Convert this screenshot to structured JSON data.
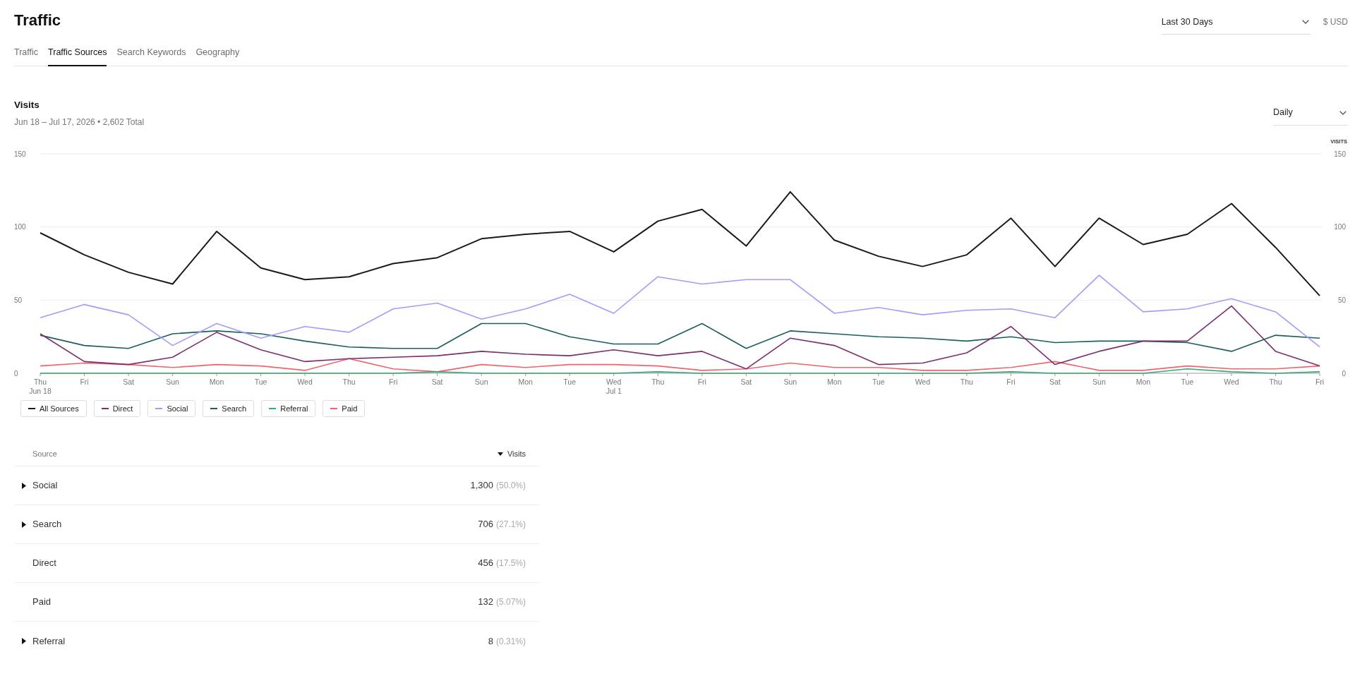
{
  "header": {
    "title": "Traffic",
    "date_range": "Last 30 Days",
    "currency": "$ USD"
  },
  "tabs": [
    {
      "label": "Traffic",
      "selected": false
    },
    {
      "label": "Traffic Sources",
      "selected": true
    },
    {
      "label": "Search Keywords",
      "selected": false
    },
    {
      "label": "Geography",
      "selected": false
    }
  ],
  "visits_panel": {
    "title": "Visits",
    "subtitle": "Jun 18 – Jul 17, 2026 • 2,602 Total",
    "interval": "Daily",
    "right_axis": {
      "ticks": [
        "150",
        "100",
        "50",
        "0"
      ]
    },
    "chart_data": {
      "type": "line",
      "ylabel": "VISITS",
      "categories": [
        "Thu\nJun 18",
        "Fri",
        "Sat",
        "Sun",
        "Mon",
        "Tue",
        "Wed",
        "Thu",
        "Fri",
        "Sat",
        "Sun",
        "Mon",
        "Tue",
        "Wed\nJul 1",
        "Thu",
        "Fri",
        "Sat",
        "Sun",
        "Mon",
        "Tue",
        "Wed",
        "Thu",
        "Fri",
        "Sat",
        "Sun",
        "Mon",
        "Tue",
        "Wed",
        "Thu",
        "Fri"
      ],
      "ylim": [
        0,
        150
      ],
      "yticks": [
        0,
        50,
        100,
        150
      ],
      "series": [
        {
          "name": "All Sources",
          "color": "#1a1a1a",
          "values": [
            96,
            81,
            69,
            61,
            97,
            72,
            64,
            66,
            75,
            79,
            92,
            95,
            97,
            83,
            104,
            112,
            87,
            124,
            91,
            80,
            73,
            81,
            106,
            73,
            106,
            88,
            95,
            116,
            86,
            53
          ]
        },
        {
          "name": "Direct",
          "color": "#7d2e6f",
          "values": [
            27,
            8,
            6,
            11,
            28,
            16,
            8,
            10,
            11,
            12,
            15,
            13,
            12,
            16,
            12,
            15,
            3,
            24,
            19,
            6,
            7,
            14,
            32,
            6,
            15,
            22,
            22,
            46,
            15,
            5
          ]
        },
        {
          "name": "Social",
          "color": "#a29cff",
          "values": [
            38,
            47,
            40,
            19,
            34,
            24,
            32,
            28,
            44,
            48,
            37,
            44,
            54,
            41,
            66,
            61,
            64,
            64,
            41,
            45,
            40,
            43,
            44,
            38,
            67,
            42,
            44,
            51,
            42,
            18
          ]
        },
        {
          "name": "Search",
          "color": "#1b5e5b",
          "values": [
            26,
            19,
            17,
            27,
            29,
            27,
            22,
            18,
            17,
            17,
            34,
            34,
            25,
            20,
            20,
            34,
            17,
            29,
            27,
            25,
            24,
            22,
            25,
            21,
            22,
            22,
            21,
            15,
            26,
            24
          ]
        },
        {
          "name": "Referral",
          "color": "#3aa876",
          "values": [
            0,
            0,
            0,
            0,
            0,
            0,
            0,
            0,
            0,
            1,
            0,
            0,
            0,
            0,
            1,
            0,
            0,
            0,
            0,
            0,
            0,
            0,
            1,
            0,
            0,
            0,
            3,
            1,
            0,
            1
          ]
        },
        {
          "name": "Paid",
          "color": "#f2646c",
          "values": [
            5,
            7,
            6,
            4,
            6,
            5,
            2,
            10,
            3,
            1,
            6,
            4,
            6,
            6,
            5,
            2,
            3,
            7,
            4,
            4,
            2,
            2,
            4,
            8,
            2,
            2,
            5,
            3,
            3,
            5
          ]
        }
      ]
    }
  },
  "table": {
    "columns": [
      {
        "label": "Source",
        "sorted": false
      },
      {
        "label": "Visits",
        "sorted": true
      }
    ],
    "rows": [
      {
        "source": "Social",
        "visits": "1,300",
        "share": "(50.0%)",
        "expandable": true,
        "expanded": false
      },
      {
        "source": "Search",
        "visits": "706",
        "share": "(27.1%)",
        "expandable": true,
        "expanded": false
      },
      {
        "source": "Direct",
        "visits": "456",
        "share": "(17.5%)",
        "expandable": false
      },
      {
        "source": "Paid",
        "visits": "132",
        "share": "(5.07%)",
        "expandable": false
      },
      {
        "source": "Referral",
        "visits": "8",
        "share": "(0.31%)",
        "expandable": true,
        "expanded": false
      }
    ]
  }
}
